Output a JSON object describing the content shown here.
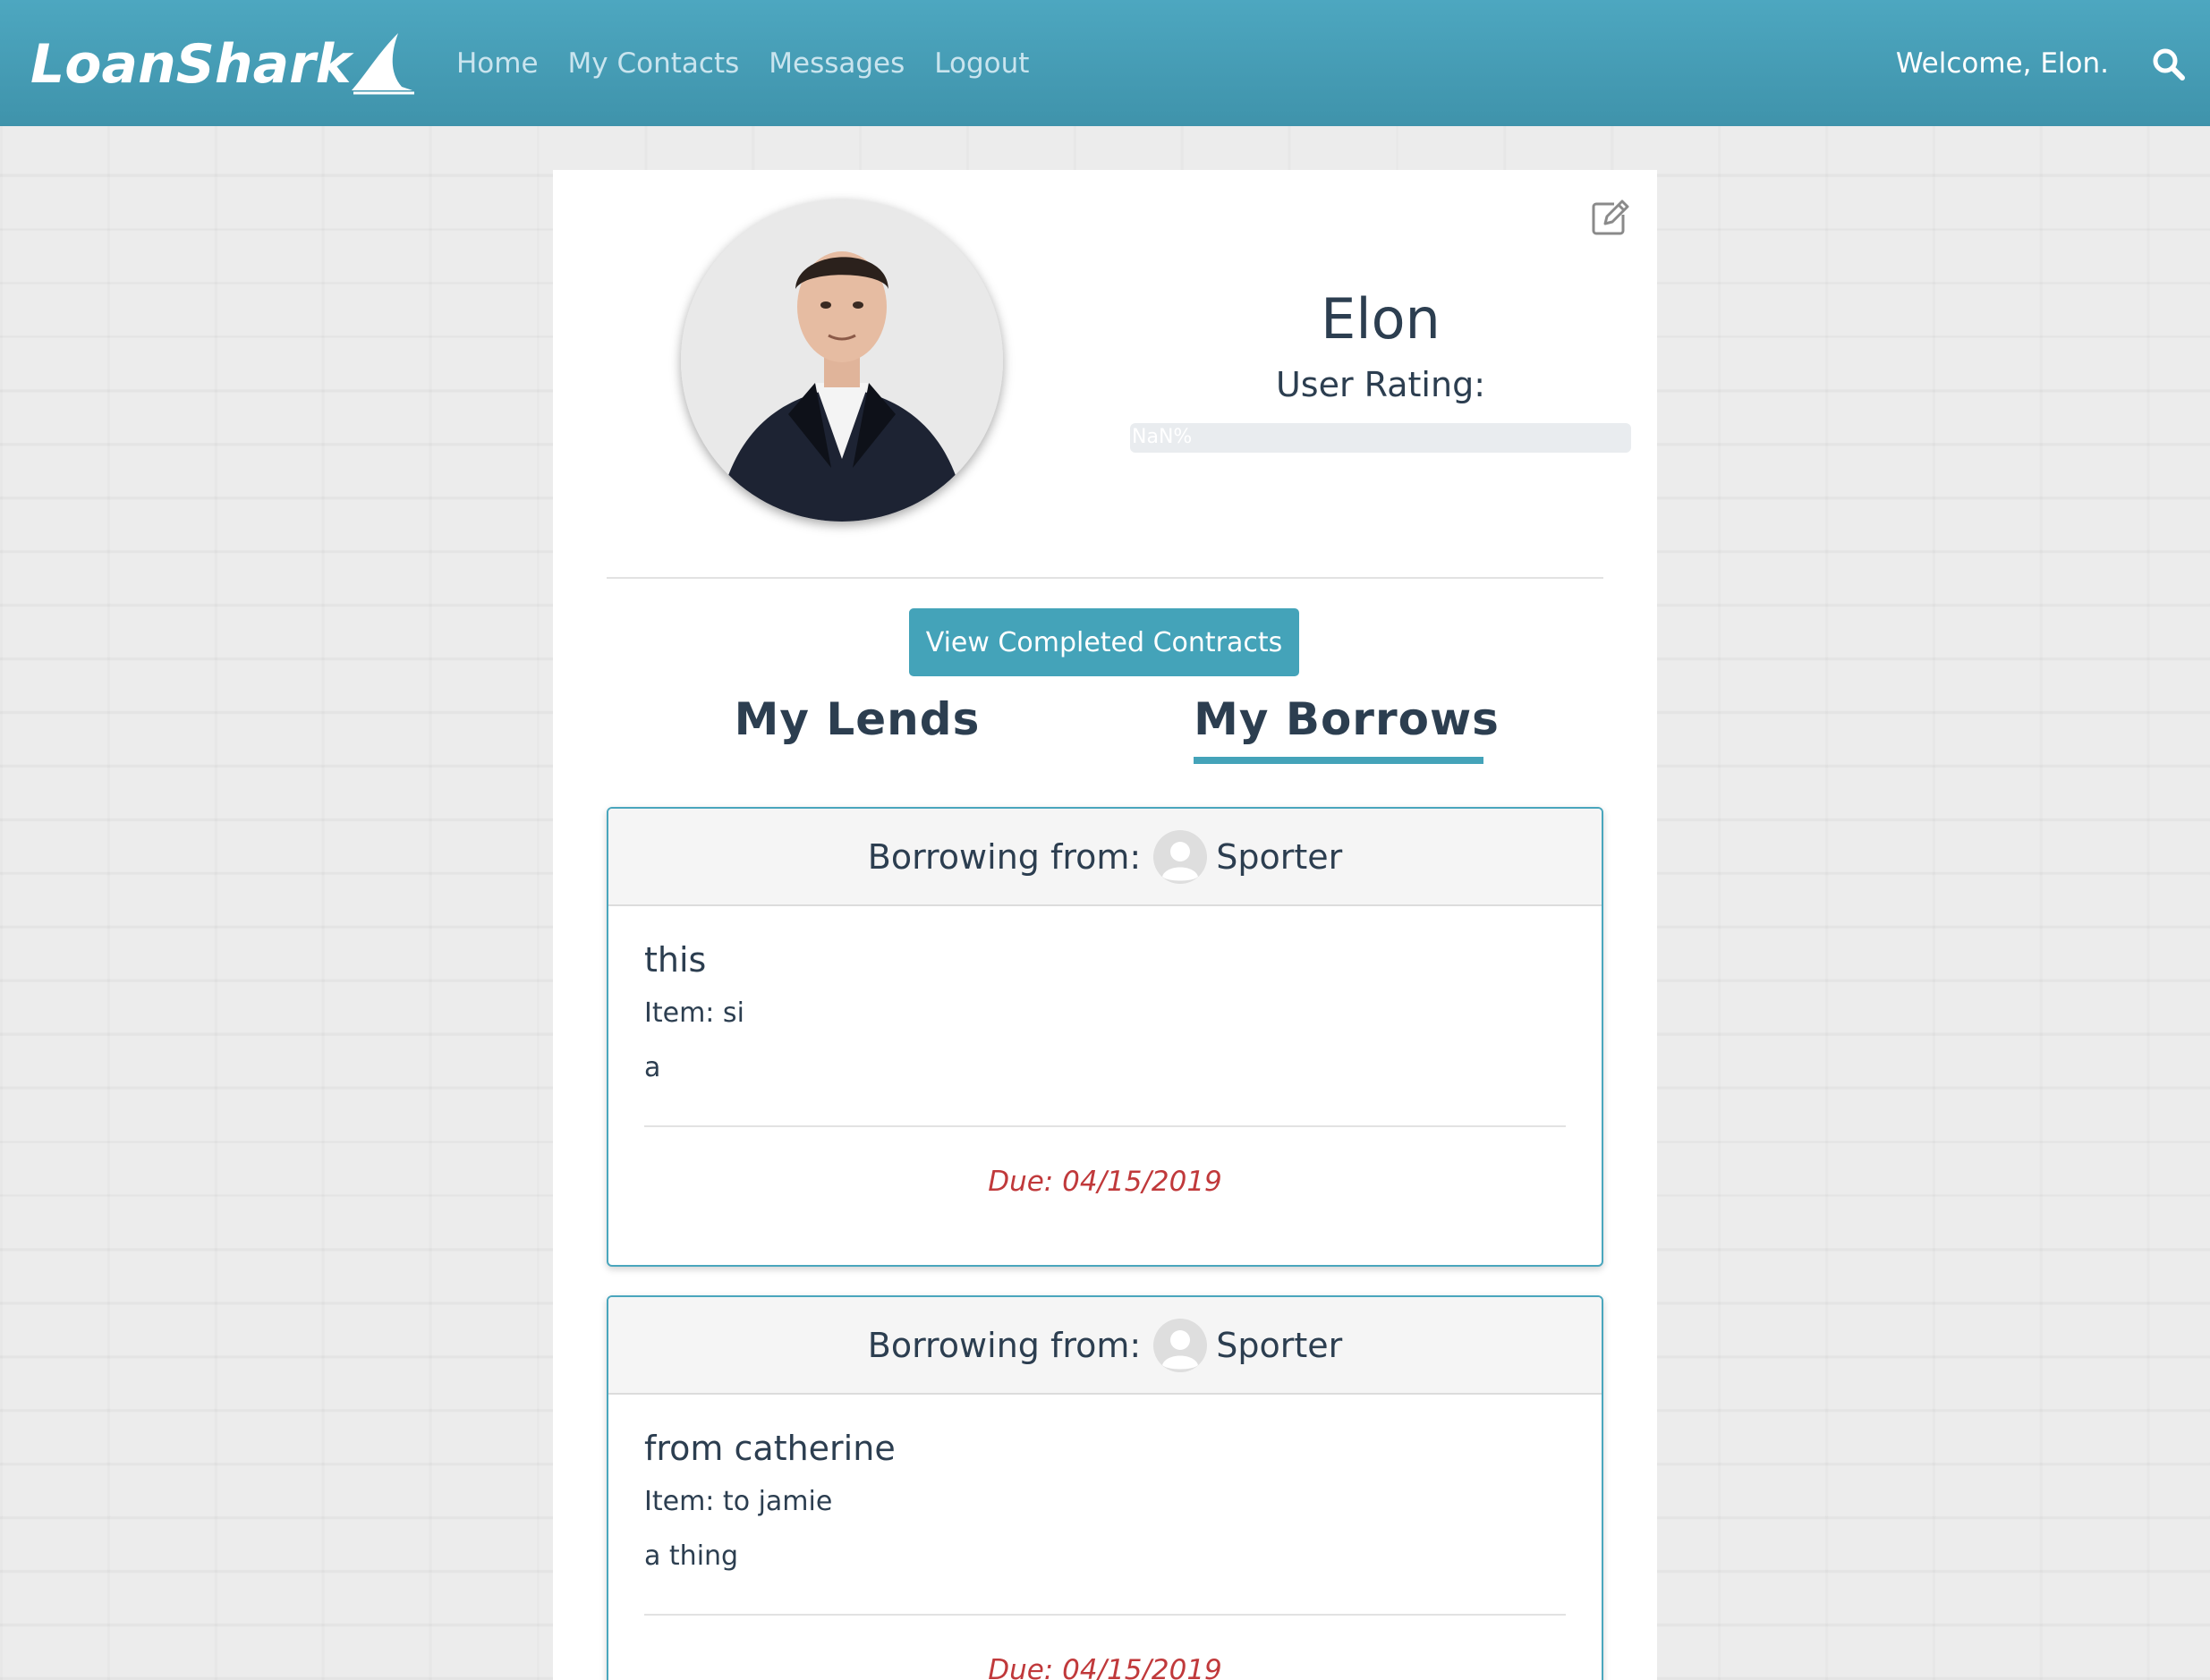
{
  "brand": {
    "name": "LoanShark"
  },
  "nav": {
    "links": [
      {
        "label": "Home"
      },
      {
        "label": "My Contacts"
      },
      {
        "label": "Messages"
      },
      {
        "label": "Logout"
      }
    ],
    "welcome": "Welcome, Elon.",
    "search_icon": "search-icon"
  },
  "profile": {
    "name": "Elon",
    "rating_label": "User Rating:",
    "rating_text": "NaN%",
    "edit_icon": "edit-icon"
  },
  "actions": {
    "completed_label": "View Completed Contracts"
  },
  "tabs": {
    "lends": "My Lends",
    "borrows": "My Borrows",
    "active": "borrows"
  },
  "contracts": [
    {
      "header_prefix": "Borrowing from:",
      "lender": "Sporter",
      "title": "this",
      "item": "Item: si",
      "description": "a",
      "due": "Due: 04/15/2019"
    },
    {
      "header_prefix": "Borrowing from:",
      "lender": "Sporter",
      "title": "from catherine",
      "item": "Item: to jamie",
      "description": "a thing",
      "due": "Due: 04/15/2019"
    }
  ],
  "colors": {
    "accent": "#44a3b9",
    "navbar": "#4da7c0",
    "due": "#c0393b",
    "text": "#2c3e50"
  }
}
